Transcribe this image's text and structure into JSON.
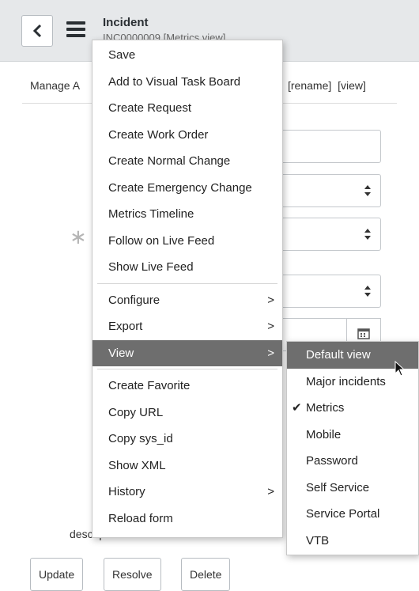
{
  "header": {
    "title": "Incident",
    "subtitle": "INC0000009 [Metrics view]"
  },
  "form": {
    "manage_link": "Manage A",
    "rename_label": "[rename]",
    "view_label": "[view]",
    "description_label": "description",
    "buttons": {
      "update": "Update",
      "resolve": "Resolve",
      "delete": "Delete"
    }
  },
  "context_menu": {
    "items": [
      {
        "label": "Save"
      },
      {
        "label": "Add to Visual Task Board"
      },
      {
        "label": "Create Request"
      },
      {
        "label": "Create Work Order"
      },
      {
        "label": "Create Normal Change"
      },
      {
        "label": "Create Emergency Change"
      },
      {
        "label": "Metrics Timeline"
      },
      {
        "label": "Follow on Live Feed"
      },
      {
        "label": "Show Live Feed"
      },
      {
        "label": "Configure"
      },
      {
        "label": "Export"
      },
      {
        "label": "View"
      },
      {
        "label": "Create Favorite"
      },
      {
        "label": "Copy URL"
      },
      {
        "label": "Copy sys_id"
      },
      {
        "label": "Show XML"
      },
      {
        "label": "History"
      },
      {
        "label": "Reload form"
      }
    ],
    "submenu_chevron": ">"
  },
  "view_submenu": {
    "items": [
      {
        "label": "Default view",
        "selected": true
      },
      {
        "label": "Major incidents"
      },
      {
        "label": "Metrics",
        "checked": true
      },
      {
        "label": "Mobile"
      },
      {
        "label": "Password"
      },
      {
        "label": "Self Service"
      },
      {
        "label": "Service Portal"
      },
      {
        "label": "VTB"
      }
    ],
    "check_glyph": "✔"
  },
  "colors": {
    "header_bg": "#e6e8ea",
    "selected_bg": "#6e6e6e"
  }
}
